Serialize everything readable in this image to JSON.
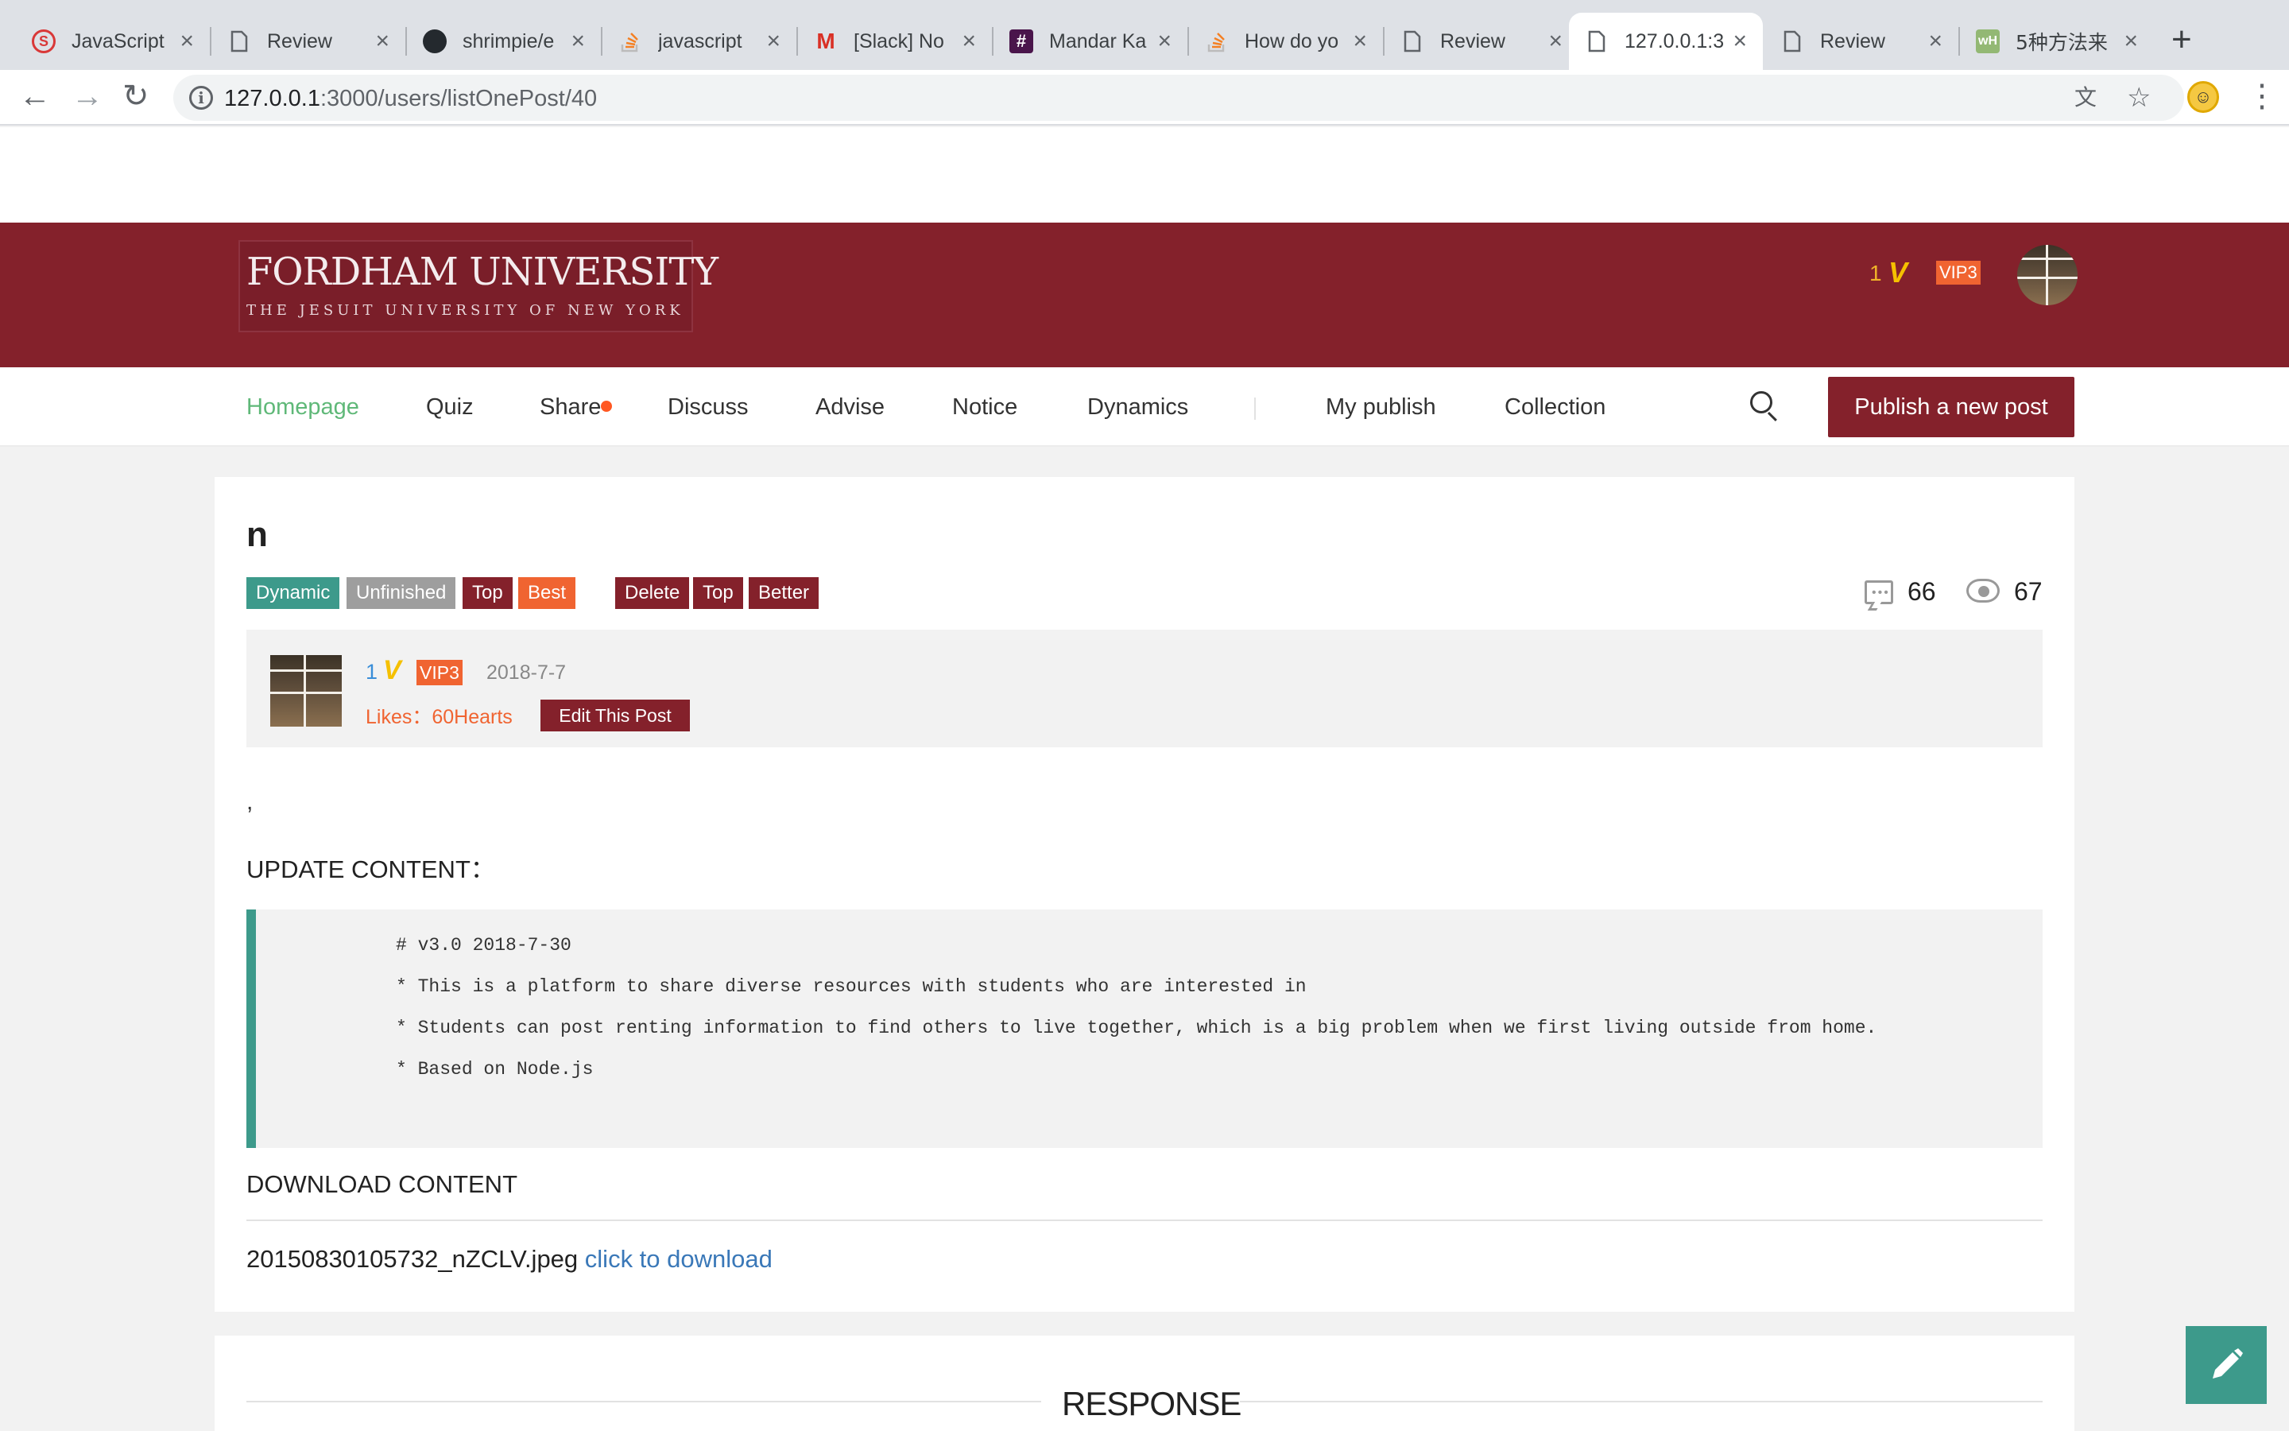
{
  "browser": {
    "tabs": [
      {
        "title": "JavaScript",
        "icon": "orange-s-icon"
      },
      {
        "title": "Review",
        "icon": "document-icon"
      },
      {
        "title": "shrimpie/e",
        "icon": "github-icon"
      },
      {
        "title": "javascript",
        "icon": "stackoverflow-icon"
      },
      {
        "title": "[Slack] No",
        "icon": "gmail-icon"
      },
      {
        "title": "Mandar Ka",
        "icon": "slack-icon"
      },
      {
        "title": "How do yo",
        "icon": "stackoverflow-icon"
      },
      {
        "title": "Review",
        "icon": "document-icon"
      },
      {
        "title": "127.0.0.1:3",
        "icon": "document-icon",
        "active": true
      },
      {
        "title": "Review",
        "icon": "document-icon"
      },
      {
        "title": "5种方法来",
        "icon": "wikihow-icon"
      }
    ],
    "url_host": "127.0.0.1",
    "url_rest": ":3000/users/listOnePost/40"
  },
  "header": {
    "logo_title": "FORDHAM UNIVERSITY",
    "logo_subtitle": "THE JESUIT UNIVERSITY OF NEW YORK",
    "user_level": "1",
    "vip": "VIP3"
  },
  "nav": {
    "items": [
      "Homepage",
      "Quiz",
      "Share",
      "Discuss",
      "Advise",
      "Notice",
      "Dynamics"
    ],
    "my_publish": "My publish",
    "collection": "Collection",
    "publish_button": "Publish a new post"
  },
  "post": {
    "title": "n",
    "badges": [
      "Dynamic",
      "Unfinished",
      "Top",
      "Best"
    ],
    "admin_badges": [
      "Delete",
      "Top",
      "Better"
    ],
    "comments": "66",
    "views": "67",
    "author": {
      "level": "1",
      "vip": "VIP3",
      "date": "2018-7-7",
      "likes": "Likes：60Hearts",
      "edit_button": "Edit This Post"
    },
    "body_comma": ",",
    "update_title": "UPDATE CONTENT：",
    "code_lines": [
      "# v3.0 2018-7-30",
      "* This is a platform to share diverse resources with students who are interested in",
      "* Students can post renting information to find others to live together, which is a big problem when we first living outside from home.",
      "* Based on Node.js"
    ],
    "download_title": "DOWNLOAD CONTENT",
    "file_name": "20150830105732_nZCLV.jpeg",
    "download_link": "click to download"
  },
  "response": {
    "title": "RESPONSE"
  },
  "colors": {
    "brand": "#84212b",
    "accent": "#5fb878",
    "teal": "#3d9a8b",
    "orange": "#f06431"
  }
}
